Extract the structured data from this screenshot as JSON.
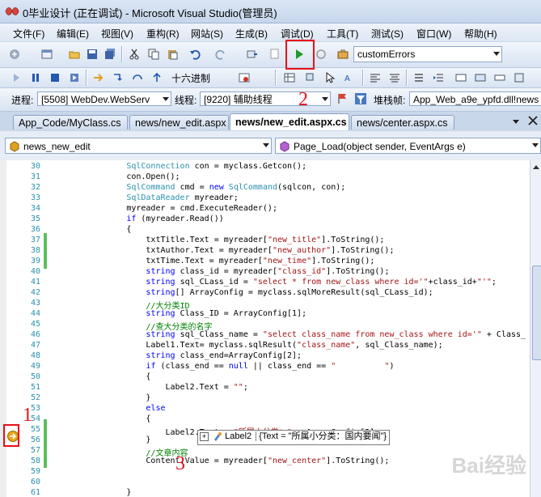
{
  "window": {
    "title": "0毕业设计 (正在调试) - Microsoft Visual Studio(管理员)"
  },
  "menu": [
    "文件(F)",
    "编辑(E)",
    "视图(V)",
    "重构(R)",
    "网站(S)",
    "生成(B)",
    "调试(D)",
    "工具(T)",
    "测试(S)",
    "窗口(W)",
    "帮助(H)"
  ],
  "toolbar1": {
    "config_combo": "customErrors",
    "start_icon": "play-icon"
  },
  "toolbar2": {
    "hex_label": "十六进制"
  },
  "toolbar3": {
    "process_label": "进程:",
    "process_value": "[5508] WebDev.WebServ",
    "thread_label": "线程:",
    "thread_value": "[9220] 辅助线程",
    "stackframe_label": "堆栈帧:",
    "stackframe_value": "App_Web_a9e_ypfd.dll!news"
  },
  "tabs": [
    "App_Code/MyClass.cs",
    "news/new_edit.aspx",
    "news/new_edit.aspx.cs",
    "news/center.aspx.cs"
  ],
  "nav": {
    "class_combo": "news_new_edit",
    "method_combo": "Page_Load(object sender, EventArgs e)"
  },
  "annotations": {
    "a1": "1",
    "a2": "2",
    "a3": "3"
  },
  "datatip": {
    "name": "Label2",
    "value": "{Text = \"所属小分类：国内要闻\"}"
  },
  "watermark": "Bai经验",
  "colors": {
    "annotation": "#e8101a",
    "keyword": "#0000ff",
    "type": "#2b91af",
    "string": "#a31515",
    "comment": "#008000"
  },
  "code": {
    "lines": [
      {
        "n": "30",
        "segs": [
          {
            "t": "                SqlConnection",
            "c": "ty"
          },
          {
            "t": " con = myclass.Getcon();"
          }
        ]
      },
      {
        "n": "31",
        "segs": [
          {
            "t": "                con.Open();"
          }
        ]
      },
      {
        "n": "32",
        "segs": [
          {
            "t": "                SqlCommand",
            "c": "ty"
          },
          {
            "t": " cmd = "
          },
          {
            "t": "new",
            "c": "kw"
          },
          {
            "t": " "
          },
          {
            "t": "SqlCommand",
            "c": "ty"
          },
          {
            "t": "(sqlcon, con);"
          }
        ]
      },
      {
        "n": "33",
        "segs": [
          {
            "t": "                SqlDataReader",
            "c": "ty"
          },
          {
            "t": " myreader;"
          }
        ]
      },
      {
        "n": "34",
        "segs": [
          {
            "t": "                myreader = cmd.ExecuteReader();"
          }
        ]
      },
      {
        "n": "35",
        "segs": [
          {
            "t": "                "
          },
          {
            "t": "if",
            "c": "kw"
          },
          {
            "t": " (myreader.Read())"
          }
        ]
      },
      {
        "n": "36",
        "segs": [
          {
            "t": "                {"
          }
        ]
      },
      {
        "n": "37",
        "segs": [
          {
            "t": "                    txtTitle.Text = myreader["
          },
          {
            "t": "\"new_title\"",
            "c": "st"
          },
          {
            "t": "].ToString();"
          }
        ]
      },
      {
        "n": "38",
        "segs": [
          {
            "t": "                    txtAuthor.Text = myreader["
          },
          {
            "t": "\"new_author\"",
            "c": "st"
          },
          {
            "t": "].ToString();"
          }
        ]
      },
      {
        "n": "39",
        "segs": [
          {
            "t": "                    txtTime.Text = myreader["
          },
          {
            "t": "\"new_time\"",
            "c": "st"
          },
          {
            "t": "].ToString();"
          }
        ]
      },
      {
        "n": "40",
        "segs": [
          {
            "t": "                    "
          },
          {
            "t": "string",
            "c": "kw"
          },
          {
            "t": " class_id = myreader["
          },
          {
            "t": "\"class_id\"",
            "c": "st"
          },
          {
            "t": "].ToString();"
          }
        ]
      },
      {
        "n": "41",
        "segs": [
          {
            "t": "                    "
          },
          {
            "t": "string",
            "c": "kw"
          },
          {
            "t": " sql_CLass_id = "
          },
          {
            "t": "\"select * from new_class where id='\"",
            "c": "st"
          },
          {
            "t": "+class_id+"
          },
          {
            "t": "\"'\"",
            "c": "st"
          },
          {
            "t": ";"
          }
        ]
      },
      {
        "n": "42",
        "segs": [
          {
            "t": "                    "
          },
          {
            "t": "string",
            "c": "kw"
          },
          {
            "t": "[] ArrayConfig = myclass.sqlMoreResult(sql_CLass_id);"
          }
        ]
      },
      {
        "n": "43",
        "segs": [
          {
            "t": "                    //大分类ID",
            "c": "cm"
          }
        ]
      },
      {
        "n": "44",
        "segs": [
          {
            "t": "                    "
          },
          {
            "t": "string",
            "c": "kw"
          },
          {
            "t": " Class_ID = ArrayConfig[1];"
          }
        ]
      },
      {
        "n": "45",
        "segs": [
          {
            "t": "                    //查大分类的名字",
            "c": "cm"
          }
        ]
      },
      {
        "n": "46",
        "segs": [
          {
            "t": "                    "
          },
          {
            "t": "string",
            "c": "kw"
          },
          {
            "t": " sql_Class_name = "
          },
          {
            "t": "\"select class_name from new_class where id='\"",
            "c": "st"
          },
          {
            "t": " + Class_"
          }
        ]
      },
      {
        "n": "47",
        "segs": [
          {
            "t": "                    Label1.Text= myclass.sqlResult("
          },
          {
            "t": "\"class_name\"",
            "c": "st"
          },
          {
            "t": ", sql_Class_name);"
          }
        ]
      },
      {
        "n": "48",
        "segs": [
          {
            "t": "                    "
          },
          {
            "t": "string",
            "c": "kw"
          },
          {
            "t": " class_end=ArrayConfig[2];"
          }
        ]
      },
      {
        "n": "49",
        "segs": [
          {
            "t": "                    "
          },
          {
            "t": "if",
            "c": "kw"
          },
          {
            "t": " (class_end == "
          },
          {
            "t": "null",
            "c": "kw"
          },
          {
            "t": " || class_end == "
          },
          {
            "t": "\"          \"",
            "c": "st"
          },
          {
            "t": ")"
          }
        ]
      },
      {
        "n": "50",
        "segs": [
          {
            "t": "                    {"
          }
        ]
      },
      {
        "n": "51",
        "segs": [
          {
            "t": "                        Label2.Text = "
          },
          {
            "t": "\"\"",
            "c": "st"
          },
          {
            "t": ";"
          }
        ]
      },
      {
        "n": "52",
        "segs": [
          {
            "t": "                    }"
          }
        ]
      },
      {
        "n": "53",
        "segs": [
          {
            "t": "                    "
          },
          {
            "t": "else",
            "c": "kw"
          }
        ]
      },
      {
        "n": "54",
        "segs": [
          {
            "t": "                    {"
          }
        ]
      },
      {
        "n": "55",
        "segs": [
          {
            "t": "                        Label2.Text = "
          },
          {
            "t": "\"所属小分类：\"",
            "c": "st"
          },
          {
            "t": " + ArrayConfig[3];"
          }
        ]
      },
      {
        "n": "56",
        "segs": [
          {
            "t": "                    }"
          }
        ]
      },
      {
        "n": "57",
        "segs": [
          {
            "t": "                    //文章内容",
            "c": "cm"
          }
        ]
      },
      {
        "n": "58",
        "segs": [
          {
            "t": "                    Content.Value = myreader["
          },
          {
            "t": "\"new_center\"",
            "c": "st"
          },
          {
            "t": "].ToString();"
          }
        ]
      },
      {
        "n": "59",
        "segs": [
          {
            "t": ""
          }
        ]
      },
      {
        "n": "60",
        "segs": [
          {
            "t": ""
          }
        ]
      },
      {
        "n": "61",
        "segs": [
          {
            "t": "                }"
          }
        ]
      }
    ]
  }
}
